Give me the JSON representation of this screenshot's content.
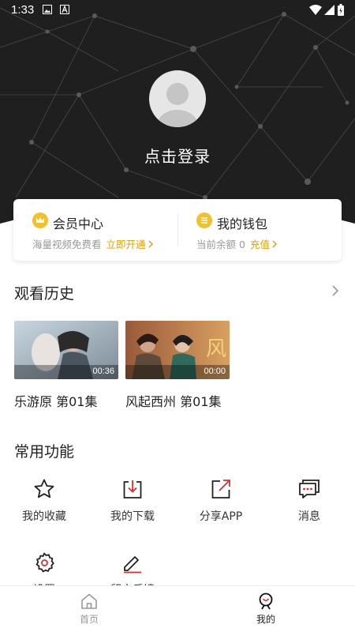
{
  "status_bar": {
    "time": "1:33"
  },
  "header": {
    "login_text": "点击登录"
  },
  "member_card": {
    "vip": {
      "title": "会员中心",
      "desc": "海量视频免费看",
      "link": "立即开通"
    },
    "wallet": {
      "title": "我的钱包",
      "desc": "当前余额 0",
      "link": "充值"
    }
  },
  "history": {
    "title": "观看历史",
    "items": [
      {
        "title": "乐游原 第01集",
        "duration": "00:36"
      },
      {
        "title": "风起西州 第01集",
        "duration": "00:00"
      }
    ]
  },
  "functions": {
    "title": "常用功能",
    "items": [
      {
        "label": "我的收藏",
        "icon": "star-icon"
      },
      {
        "label": "我的下载",
        "icon": "download-icon"
      },
      {
        "label": "分享APP",
        "icon": "share-icon"
      },
      {
        "label": "消息",
        "icon": "message-icon"
      },
      {
        "label": "设置",
        "icon": "gear-icon"
      },
      {
        "label": "留言反馈",
        "icon": "edit-icon"
      }
    ]
  },
  "tabbar": {
    "items": [
      {
        "label": "首页",
        "icon": "home-icon"
      },
      {
        "label": "我的",
        "icon": "profile-icon"
      }
    ]
  },
  "colors": {
    "accent": "#e0a100",
    "header_bg": "#1f1f1f",
    "share_red": "#e02b2b"
  }
}
